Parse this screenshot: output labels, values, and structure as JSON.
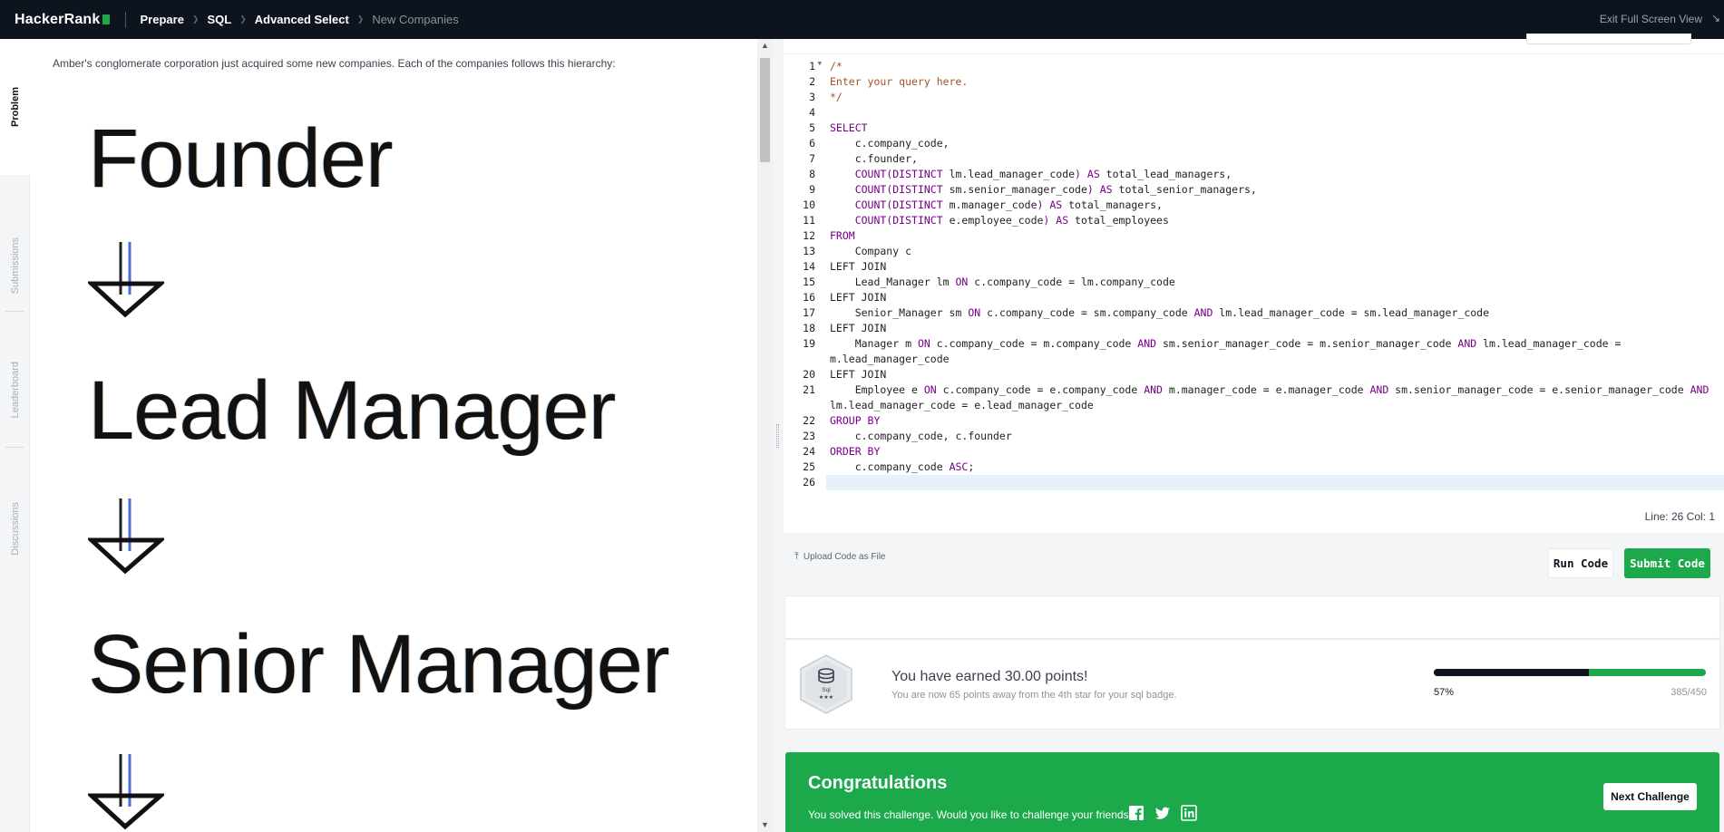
{
  "brand": {
    "name": "HackerRank"
  },
  "breadcrumb": [
    "Prepare",
    "SQL",
    "Advanced Select",
    "New Companies"
  ],
  "header": {
    "exit_label": "Exit Full Screen View"
  },
  "tabs": [
    "Problem",
    "Submissions",
    "Leaderboard",
    "Discussions"
  ],
  "problem": {
    "intro": "Amber's conglomerate corporation just acquired some new companies. Each of the companies follows this hierarchy:",
    "hierarchy": [
      "Founder",
      "Lead Manager",
      "Senior Manager"
    ]
  },
  "editor": {
    "line_numbers": [
      "1",
      "2",
      "3",
      "4",
      "5",
      "6",
      "7",
      "8",
      "9",
      "10",
      "11",
      "12",
      "13",
      "14",
      "15",
      "16",
      "17",
      "18",
      "19",
      "20",
      "21",
      "22",
      "23",
      "24",
      "25",
      "26"
    ],
    "status": "Line: 26 Col: 1"
  },
  "actions": {
    "upload_label": "Upload Code as File",
    "run_label": "Run Code",
    "submit_label": "Submit Code"
  },
  "result": {
    "badge_label": "Sql",
    "earned": "You have earned 30.00 points!",
    "sub": "You are now 65 points away from the 4th star for your sql badge.",
    "progress_pct": "57%",
    "progress_fraction": 0.57,
    "score": "385/450"
  },
  "congrats": {
    "title": "Congratulations",
    "subtitle": "You solved this challenge. Would you like to challenge your friends?",
    "next_label": "Next Challenge"
  },
  "colors": {
    "brand_green": "#1ba94c",
    "nav_dark": "#0e141e",
    "sql_keyword": "#770088",
    "sql_comment": "#a0522d"
  }
}
